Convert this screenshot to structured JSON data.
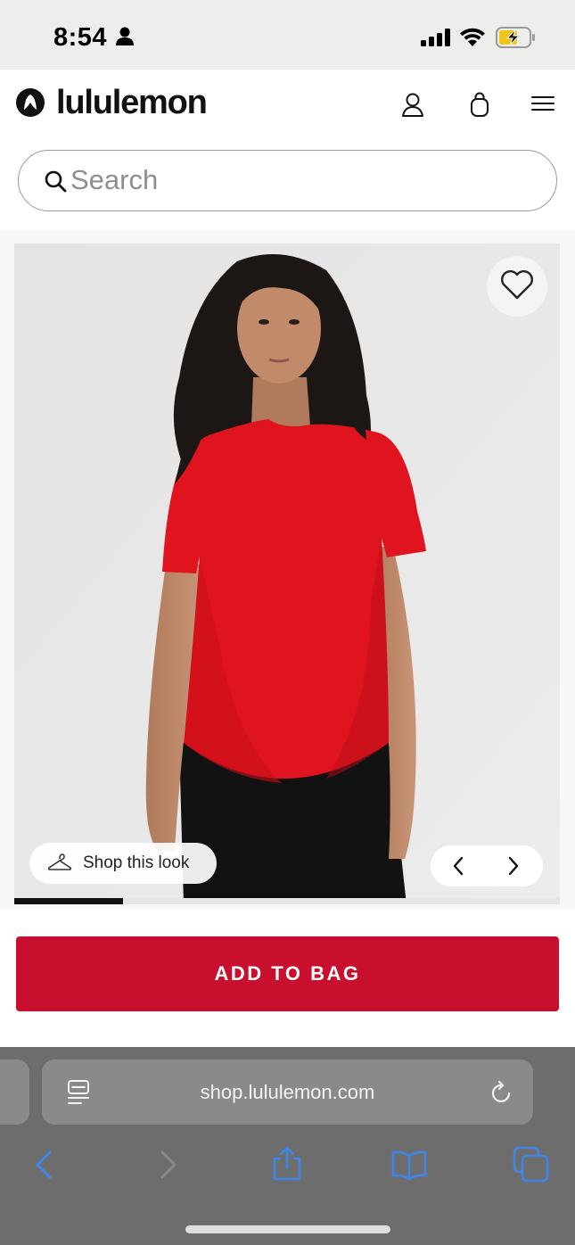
{
  "status_bar": {
    "time": "8:54"
  },
  "header": {
    "brand": "lululemon"
  },
  "search": {
    "placeholder": "Search"
  },
  "product": {
    "shop_the_look_label": "Shop this look",
    "image_progress": 0.2,
    "add_to_bag_label": "ADD TO BAG",
    "colors": {
      "shirt": "#e0141e",
      "accent": "#c8102e"
    }
  },
  "browser": {
    "url": "shop.lululemon.com"
  },
  "icons": [
    "person-icon",
    "signal-icon",
    "wifi-icon",
    "battery-charging-icon",
    "lululemon-logo-icon",
    "account-icon",
    "shopping-bag-icon",
    "hamburger-menu-icon",
    "search-icon",
    "heart-icon",
    "hanger-icon",
    "chevron-left-icon",
    "chevron-right-icon",
    "reader-icon",
    "reload-icon",
    "back-icon",
    "forward-icon",
    "share-icon",
    "bookmarks-icon",
    "tabs-icon"
  ]
}
